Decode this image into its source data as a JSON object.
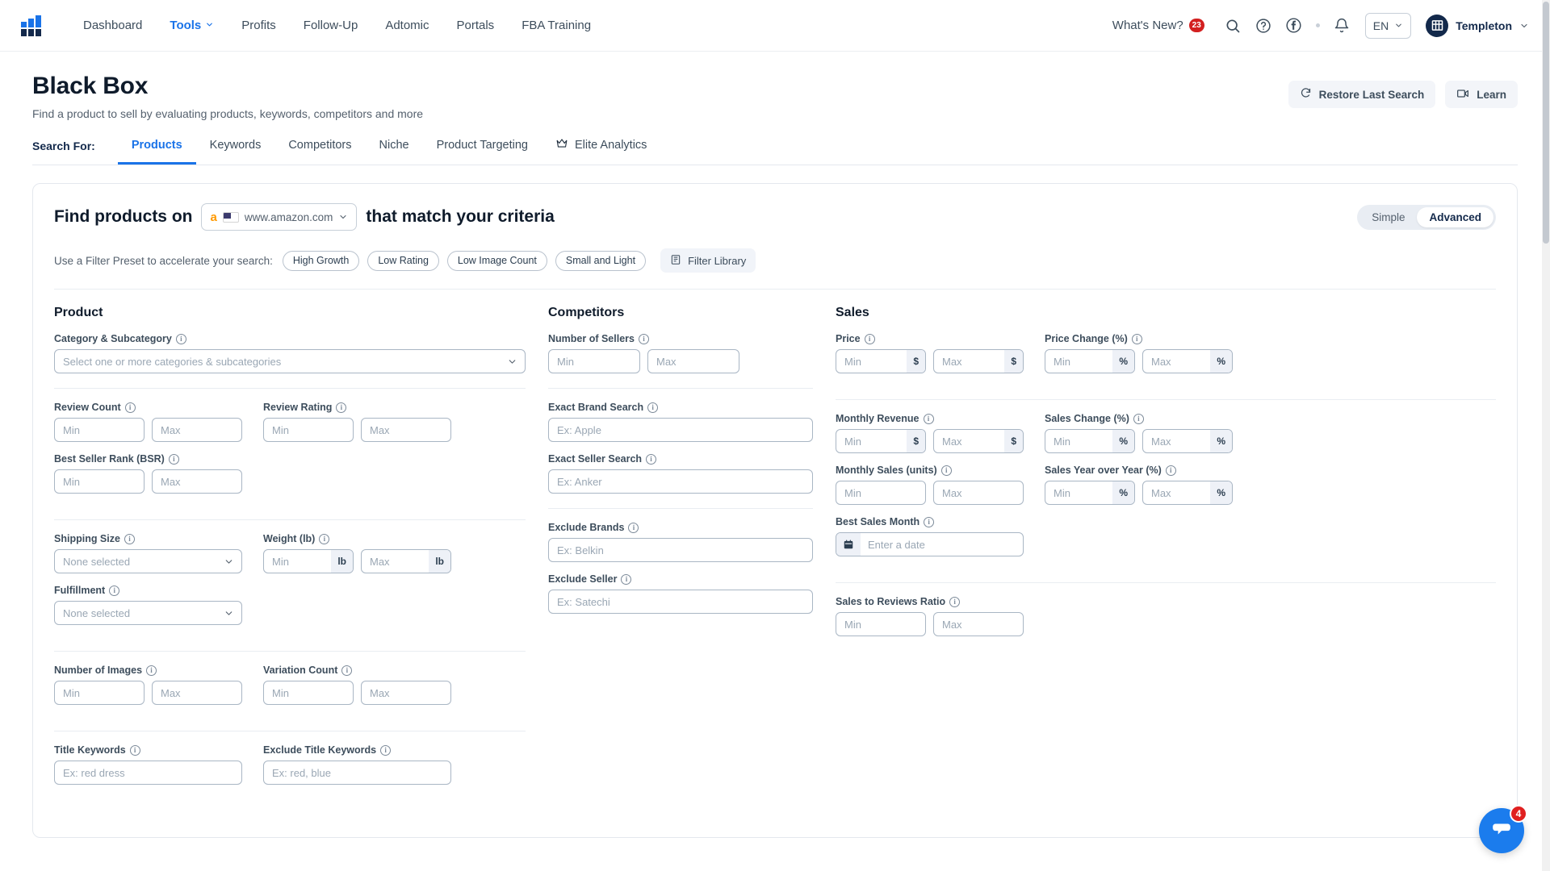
{
  "nav": {
    "logo_icon": "helium-bar-logo",
    "links": [
      {
        "label": "Dashboard",
        "active": false,
        "caret": false
      },
      {
        "label": "Tools",
        "active": true,
        "caret": true
      },
      {
        "label": "Profits",
        "active": false,
        "caret": false
      },
      {
        "label": "Follow-Up",
        "active": false,
        "caret": false
      },
      {
        "label": "Adtomic",
        "active": false,
        "caret": false
      },
      {
        "label": "Portals",
        "active": false,
        "caret": false
      },
      {
        "label": "FBA Training",
        "active": false,
        "caret": false
      }
    ],
    "whats_new": "What's New?",
    "whats_new_count": "23",
    "language": "EN",
    "user": "Templeton",
    "icons": [
      "search-icon",
      "help-icon",
      "facebook-icon",
      "bell-icon"
    ]
  },
  "page": {
    "title": "Black Box",
    "subtitle": "Find a product to sell by evaluating products, keywords, competitors and more",
    "restore_label": "Restore Last Search",
    "learn_label": "Learn"
  },
  "tabs": {
    "label": "Search For:",
    "items": [
      {
        "label": "Products",
        "active": true,
        "crown": false
      },
      {
        "label": "Keywords",
        "active": false,
        "crown": false
      },
      {
        "label": "Competitors",
        "active": false,
        "crown": false
      },
      {
        "label": "Niche",
        "active": false,
        "crown": false
      },
      {
        "label": "Product Targeting",
        "active": false,
        "crown": false
      },
      {
        "label": "Elite Analytics",
        "active": false,
        "crown": true
      }
    ]
  },
  "card": {
    "title_before": "Find products on",
    "title_after": "that match your criteria",
    "marketplace": "www.amazon.com",
    "mode_simple": "Simple",
    "mode_advanced": "Advanced",
    "mode_selected": "Advanced",
    "preset_label": "Use a Filter Preset to accelerate your search:",
    "presets": [
      "High Growth",
      "Low Rating",
      "Low Image Count",
      "Small and Light"
    ],
    "filter_library": "Filter Library"
  },
  "product": {
    "heading": "Product",
    "category": {
      "label": "Category & Subcategory",
      "placeholder": "Select one or more categories & subcategories",
      "value": ""
    },
    "review_count": {
      "label": "Review Count",
      "min": "Min",
      "max": "Max"
    },
    "review_rating": {
      "label": "Review Rating",
      "min": "Min",
      "max": "Max"
    },
    "bsr": {
      "label": "Best Seller Rank (BSR)",
      "min": "Min",
      "max": "Max"
    },
    "shipping_size": {
      "label": "Shipping Size",
      "placeholder": "None selected"
    },
    "weight": {
      "label": "Weight (lb)",
      "min": "Min",
      "max": "Max",
      "unit": "lb"
    },
    "fulfillment": {
      "label": "Fulfillment",
      "placeholder": "None selected"
    },
    "number_of_images": {
      "label": "Number of Images",
      "min": "Min",
      "max": "Max"
    },
    "variation_count": {
      "label": "Variation Count",
      "min": "Min",
      "max": "Max"
    },
    "title_keywords": {
      "label": "Title Keywords",
      "placeholder": "Ex: red dress"
    },
    "exclude_title_keywords": {
      "label": "Exclude Title Keywords",
      "placeholder": "Ex: red, blue"
    }
  },
  "competitors": {
    "heading": "Competitors",
    "number_of_sellers": {
      "label": "Number of Sellers",
      "min": "Min",
      "max": "Max"
    },
    "exact_brand_search": {
      "label": "Exact Brand Search",
      "placeholder": "Ex: Apple"
    },
    "exact_seller_search": {
      "label": "Exact Seller Search",
      "placeholder": "Ex: Anker"
    },
    "exclude_brands": {
      "label": "Exclude Brands",
      "placeholder": "Ex: Belkin"
    },
    "exclude_seller": {
      "label": "Exclude Seller",
      "placeholder": "Ex: Satechi"
    }
  },
  "sales": {
    "heading": "Sales",
    "price": {
      "label": "Price",
      "min": "Min",
      "max": "Max",
      "unit": "$"
    },
    "price_change": {
      "label": "Price Change (%)",
      "min": "Min",
      "max": "Max",
      "unit": "%"
    },
    "monthly_revenue": {
      "label": "Monthly Revenue",
      "min": "Min",
      "max": "Max",
      "unit": "$"
    },
    "sales_change": {
      "label": "Sales Change (%)",
      "min": "Min",
      "max": "Max",
      "unit": "%"
    },
    "monthly_sales": {
      "label": "Monthly Sales (units)",
      "min": "Min",
      "max": "Max"
    },
    "sales_yoy": {
      "label": "Sales Year over Year (%)",
      "min": "Min",
      "max": "Max",
      "unit": "%"
    },
    "best_sales_month": {
      "label": "Best Sales Month",
      "placeholder": "Enter a date",
      "icon": "calendar-icon"
    },
    "sales_to_reviews": {
      "label": "Sales to Reviews Ratio",
      "min": "Min",
      "max": "Max"
    }
  },
  "chat": {
    "count": "4",
    "icon": "chat-bubble-icon"
  },
  "colors": {
    "accent": "#1a73e8",
    "navy": "#13294b",
    "badge_red": "#d32020",
    "chat_blue": "#1b7ced",
    "border": "#e4e8ee",
    "input_border": "#a9b6c4"
  }
}
